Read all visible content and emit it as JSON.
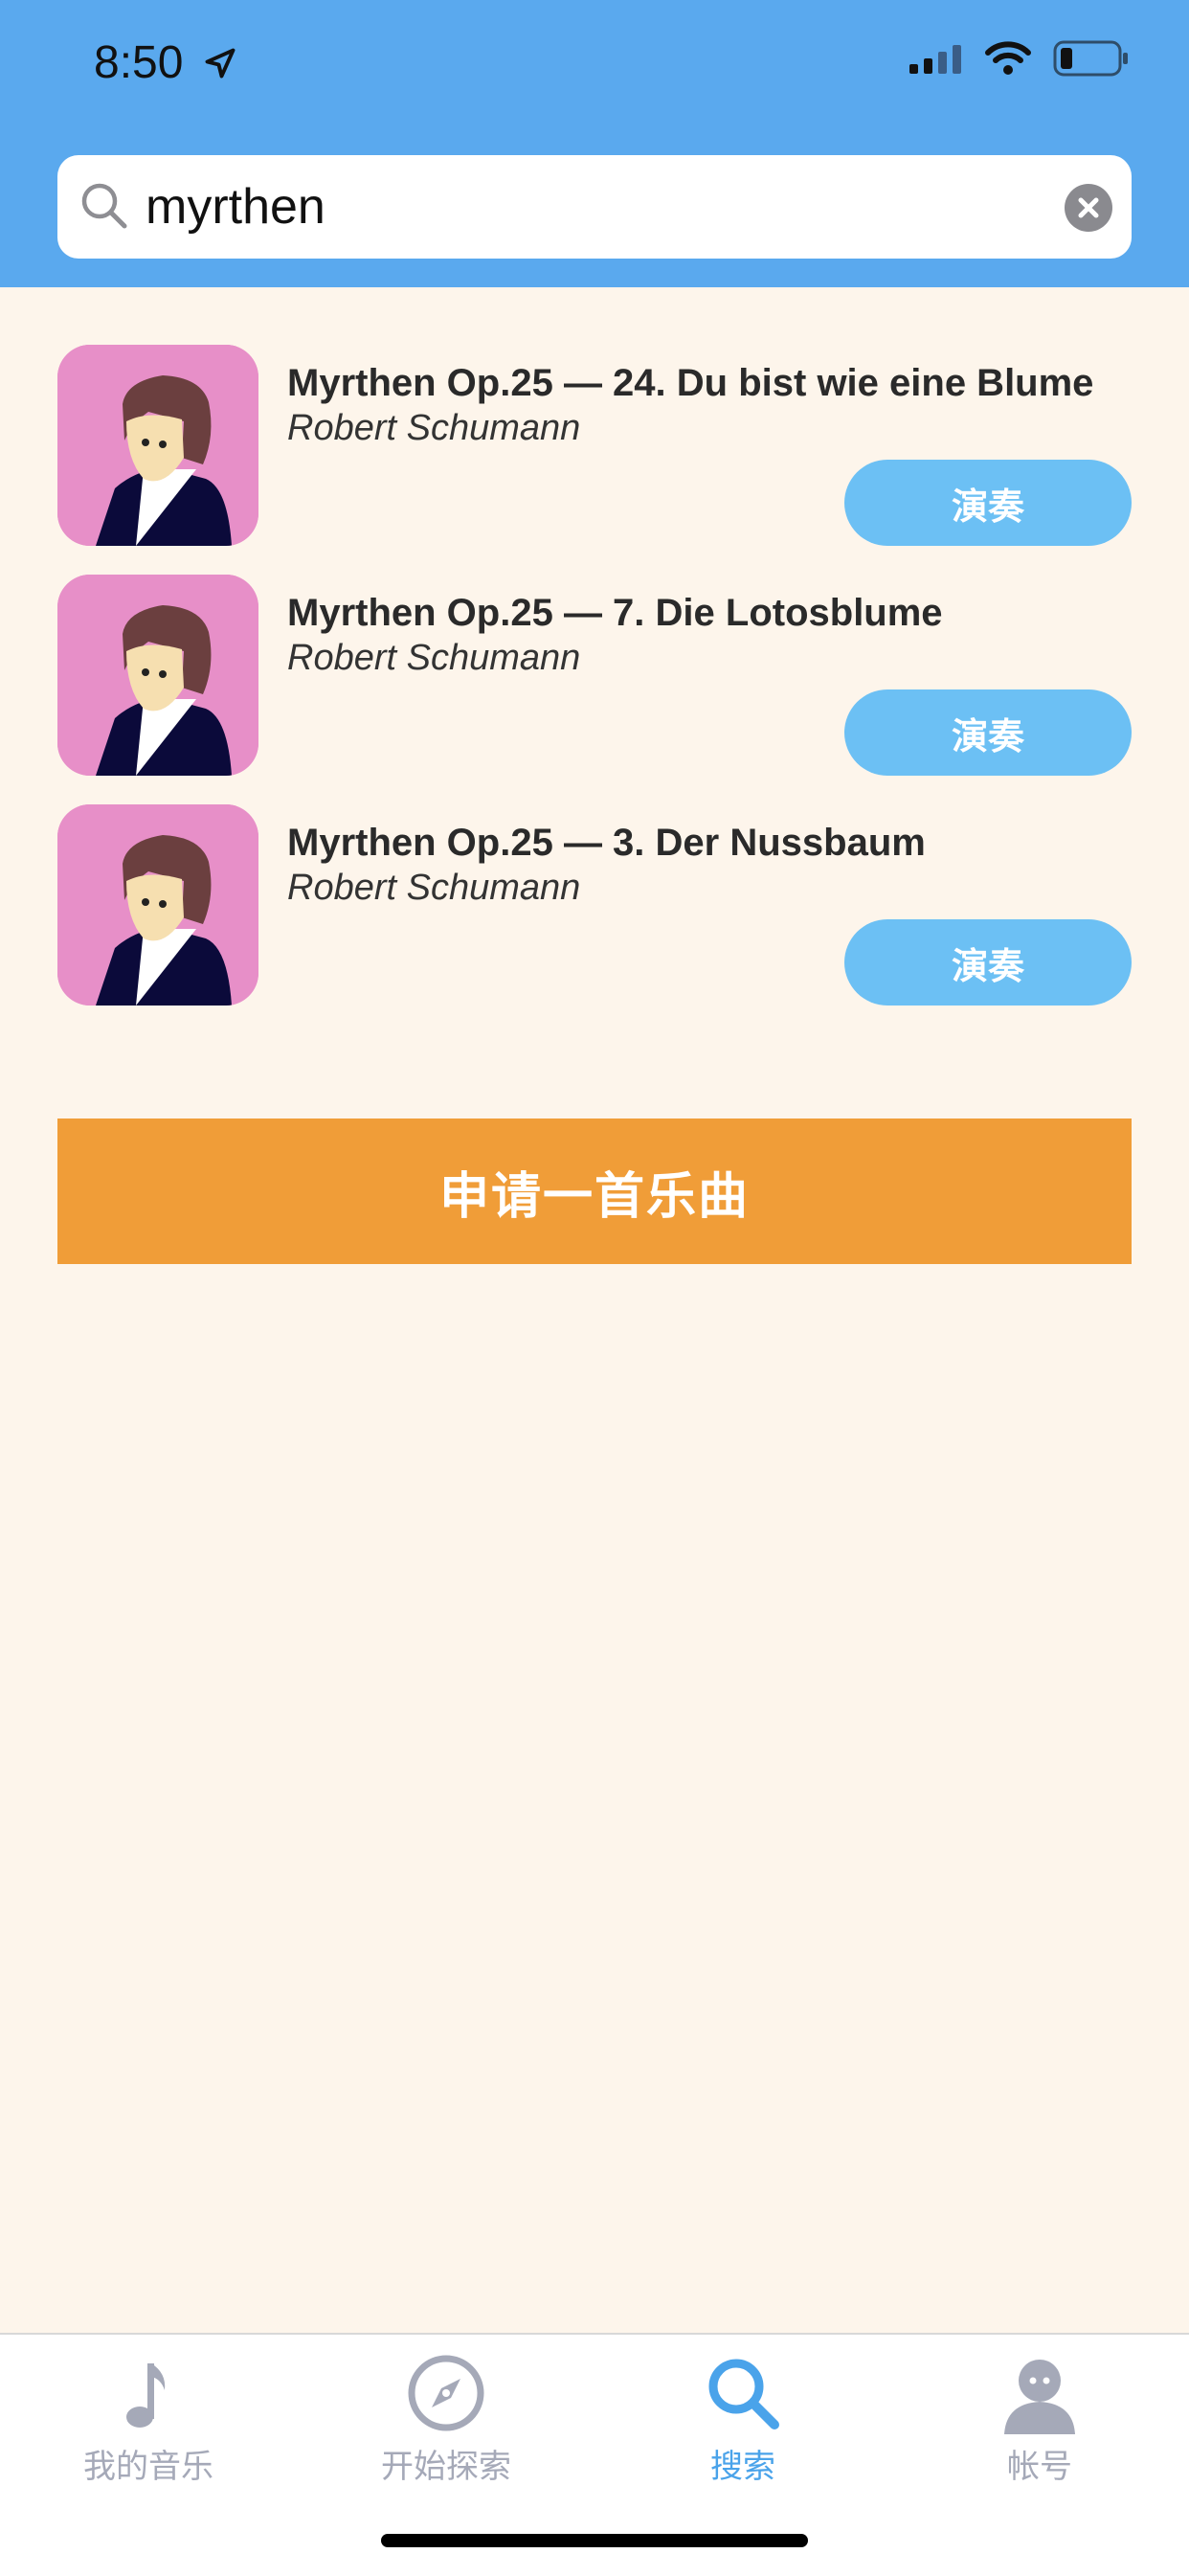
{
  "status_bar": {
    "time": "8:50"
  },
  "search": {
    "value": "myrthen"
  },
  "results": [
    {
      "title": "Myrthen Op.25 — 24. Du bist wie eine Blume",
      "artist": "Robert Schumann",
      "play_label": "演奏"
    },
    {
      "title": "Myrthen Op.25 — 7. Die Lotosblume",
      "artist": "Robert Schumann",
      "play_label": "演奏"
    },
    {
      "title": "Myrthen Op.25 — 3. Der Nussbaum",
      "artist": "Robert Schumann",
      "play_label": "演奏"
    }
  ],
  "request_button": {
    "label": "申请一首乐曲"
  },
  "tabbar": {
    "tabs": [
      {
        "label": "我的音乐",
        "icon": "music-note-icon",
        "active": false
      },
      {
        "label": "开始探索",
        "icon": "compass-icon",
        "active": false
      },
      {
        "label": "搜索",
        "icon": "search-icon",
        "active": true
      },
      {
        "label": "帐号",
        "icon": "account-icon",
        "active": false
      }
    ]
  },
  "colors": {
    "header": "#5aa9ee",
    "background": "#fdf5eb",
    "play_button": "#6cc0f4",
    "request_button": "#f09d38",
    "tab_active": "#4aa3ea",
    "tab_inactive": "#a5a9b8",
    "avatar_bg": "#e78fc8"
  }
}
